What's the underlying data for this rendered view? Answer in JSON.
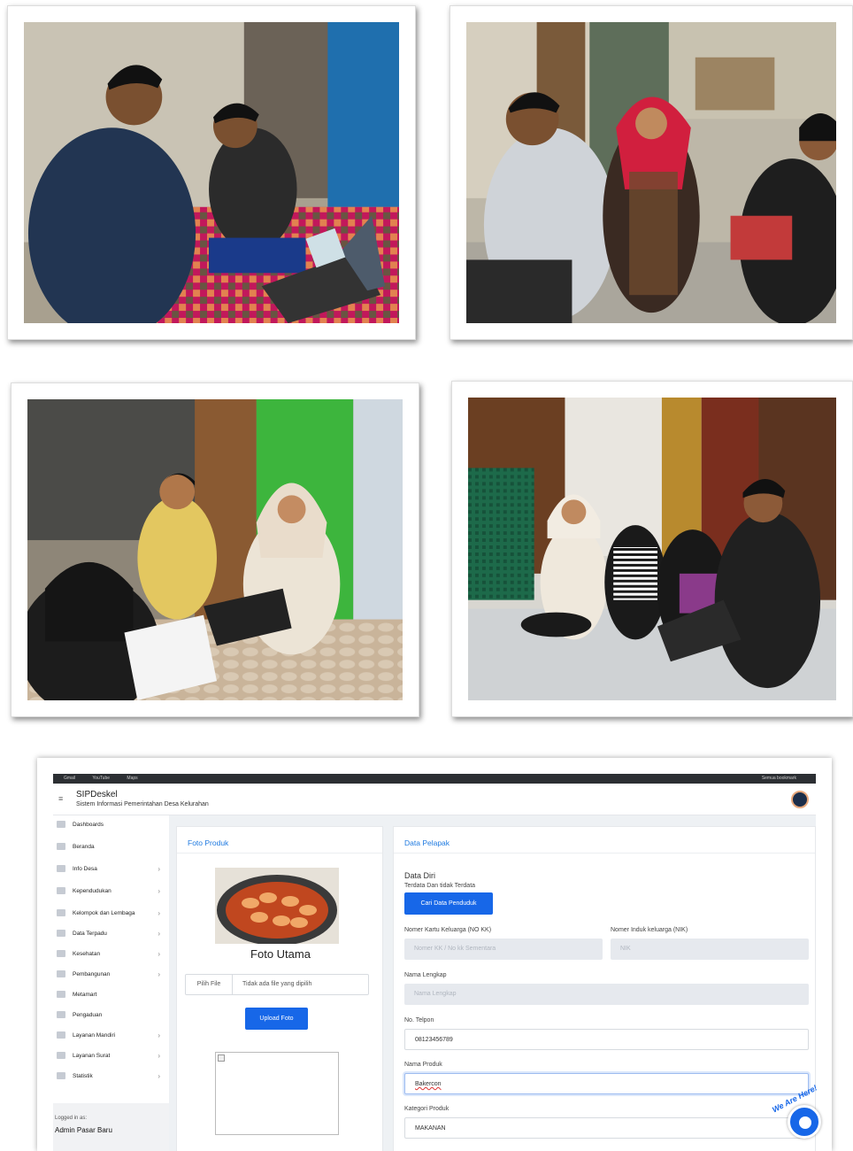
{
  "screenshot": {
    "topbar_links": [
      "Gmail",
      "YouTube",
      "Maps"
    ],
    "topbar_right": "Semua bookmark",
    "app_title": "SIPDeskel",
    "app_subtitle": "Sistem Informasi Pemerintahan Desa Kelurahan",
    "sidebar": {
      "items": [
        {
          "label": "Dashboards",
          "chevron": ""
        },
        {
          "label": "Beranda",
          "chevron": ""
        },
        {
          "label": "Info Desa",
          "chevron": "›"
        },
        {
          "label": "Kependudukan",
          "chevron": "›"
        },
        {
          "label": "Kelompok dan Lembaga",
          "chevron": "›"
        },
        {
          "label": "Data Terpadu",
          "chevron": "›"
        },
        {
          "label": "Kesehatan",
          "chevron": "›"
        },
        {
          "label": "Pembangunan",
          "chevron": "›"
        },
        {
          "label": "Metamart",
          "chevron": ""
        },
        {
          "label": "Pengaduan",
          "chevron": ""
        },
        {
          "label": "Layanan Mandiri",
          "chevron": "›"
        },
        {
          "label": "Layanan Surat",
          "chevron": "›"
        },
        {
          "label": "Statistik",
          "chevron": "›"
        }
      ],
      "logged_label": "Logged in as:",
      "logged_user": "Admin Pasar Baru"
    },
    "foto_produk": {
      "header": "Foto Produk",
      "caption": "Foto Utama",
      "file_button": "Pilih File",
      "file_status": "Tidak ada file yang dipilih",
      "upload_button": "Upload Foto"
    },
    "data_pelapak": {
      "header": "Data Pelapak",
      "section": "Data Diri",
      "subsection": "Terdata Dan tidak Terdata",
      "search_button": "Cari Data Penduduk",
      "kk_label": "Nomer Kartu Keluarga (NO KK)",
      "kk_placeholder": "Nomer KK / No kk Sementara",
      "nik_label": "Nomer Induk keluarga (NIK)",
      "nik_placeholder": "NIK",
      "nama_label": "Nama Lengkap",
      "nama_placeholder": "Nama Lengkap",
      "telpon_label": "No. Telpon",
      "telpon_value": "08123456789",
      "produk_label": "Nama Produk",
      "produk_value": "Bakercon",
      "kategori_label": "Kategori Produk",
      "kategori_value": "MAKANAN"
    },
    "chat_badge": "We Are Here!"
  }
}
